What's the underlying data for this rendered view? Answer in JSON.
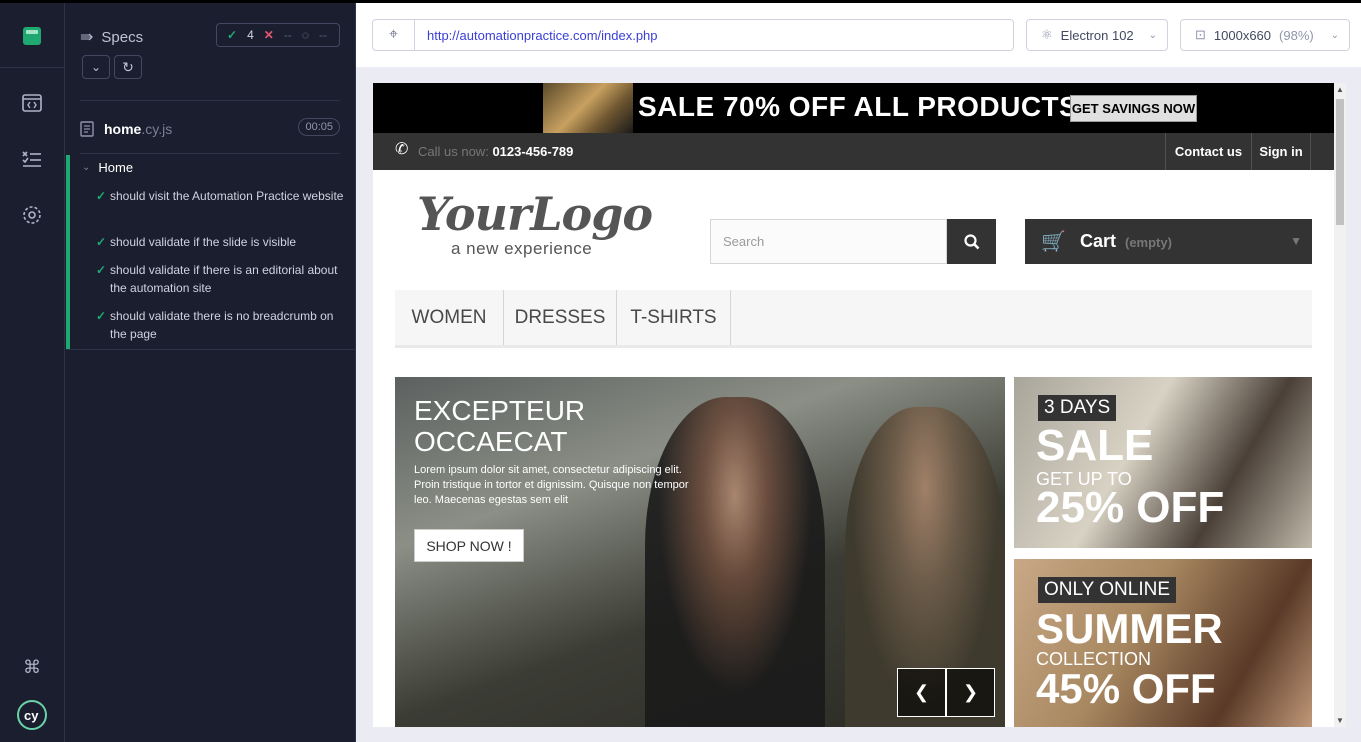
{
  "runner": {
    "specs_label": "Specs",
    "stats": {
      "passed": "4",
      "failed": "--",
      "pending": "--"
    },
    "file": {
      "name": "home",
      "ext": ".cy.js",
      "duration": "00:05"
    },
    "suite": "Home",
    "tests": [
      "should visit the Automation Practice website",
      "should validate if the slide is visible",
      "should validate if there is an editorial about the automation site",
      "should validate there is no breadcrumb on the page"
    ]
  },
  "toolbar": {
    "url": "http://automationpractice.com/index.php",
    "browser": "Electron 102",
    "viewport": "1000x660",
    "zoom": "(98%)"
  },
  "site": {
    "banner_text": "SALE 70% OFF ALL PRODUCTS",
    "banner_button": "GET SAVINGS NOW",
    "call_label": "Call us now:",
    "phone": "0123-456-789",
    "contact": "Contact us",
    "signin": "Sign in",
    "logo_main": "YourLogo",
    "logo_tagline": "a new experience",
    "search_placeholder": "Search",
    "cart_label": "Cart",
    "cart_status": "(empty)",
    "menu": [
      "WOMEN",
      "DRESSES",
      "T-SHIRTS"
    ],
    "slide": {
      "heading_1": "EXCEPTEUR",
      "heading_2": "OCCAECAT",
      "body": "Lorem ipsum dolor sit amet, consectetur adipiscing elit. Proin tristique in tortor et dignissim. Quisque non tempor leo. Maecenas egestas sem elit",
      "button": "SHOP NOW !"
    },
    "promo1": {
      "tag": "3 DAYS",
      "title": "SALE",
      "sub": "GET UP TO",
      "value": "25% OFF"
    },
    "promo2": {
      "tag": "ONLY ONLINE",
      "title": "SUMMER",
      "sub": "COLLECTION",
      "value": "45% OFF"
    }
  },
  "colors": {
    "pass": "#1fa971",
    "fail": "#e45770",
    "url": "#3a40d6"
  }
}
